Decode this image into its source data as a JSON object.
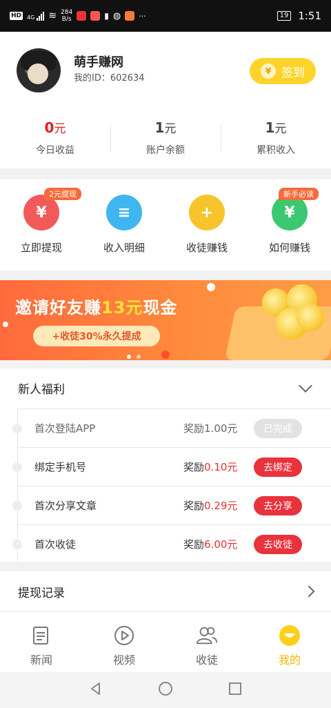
{
  "status_bar": {
    "network": "HD",
    "signal": "4G",
    "speed_value": "284",
    "speed_unit": "B/s",
    "battery": "19",
    "time": "1:51"
  },
  "profile": {
    "nickname": "萌手赚网",
    "id_label": "我的ID：",
    "id_value": "602634",
    "signin_label": "签到",
    "signin_coin": "¥"
  },
  "stats": [
    {
      "value": "0",
      "unit": "元",
      "label": "今日收益",
      "color": "#e02020"
    },
    {
      "value": "1",
      "unit": "元",
      "label": "账户余额"
    },
    {
      "value": "1",
      "unit": "元",
      "label": "累积收入"
    }
  ],
  "actions": [
    {
      "label": "立即提现",
      "icon": "yuan-icon",
      "glyph": "¥",
      "tag": "2元提现",
      "color": "#f25a5a"
    },
    {
      "label": "收入明细",
      "icon": "document-icon",
      "glyph": "≡",
      "color": "#3fb6ef"
    },
    {
      "label": "收徒赚钱",
      "icon": "add-user-icon",
      "glyph": "+",
      "color": "#f7c52b"
    },
    {
      "label": "如何赚钱",
      "icon": "money-bag-icon",
      "glyph": "¥",
      "tag": "新手必读",
      "color": "#3cc870"
    }
  ],
  "banner": {
    "title_pre": "邀请好友赚",
    "title_highlight": "13元",
    "title_post": "现金",
    "pill": "+收徒30%永久提成"
  },
  "welfare": {
    "title": "新人福利",
    "reward_prefix": "奖励",
    "tasks": [
      {
        "name": "首次登陆APP",
        "amount": "1.00元",
        "button": "已完成",
        "done": true
      },
      {
        "name": "绑定手机号",
        "amount": "0.10元",
        "button": "去绑定"
      },
      {
        "name": "首次分享文章",
        "amount": "0.29元",
        "button": "去分享"
      },
      {
        "name": "首次收徒",
        "amount": "6.00元",
        "button": "去收徒"
      }
    ]
  },
  "record": {
    "title": "提现记录"
  },
  "tabs": [
    {
      "label": "新闻",
      "icon": "news-icon"
    },
    {
      "label": "视频",
      "icon": "play-icon"
    },
    {
      "label": "收徒",
      "icon": "users-icon"
    },
    {
      "label": "我的",
      "icon": "smile-icon",
      "active": true
    }
  ],
  "colors": {
    "accent": "#ffd42a",
    "active_tab": "#f2b700",
    "danger": "#e8323c"
  }
}
